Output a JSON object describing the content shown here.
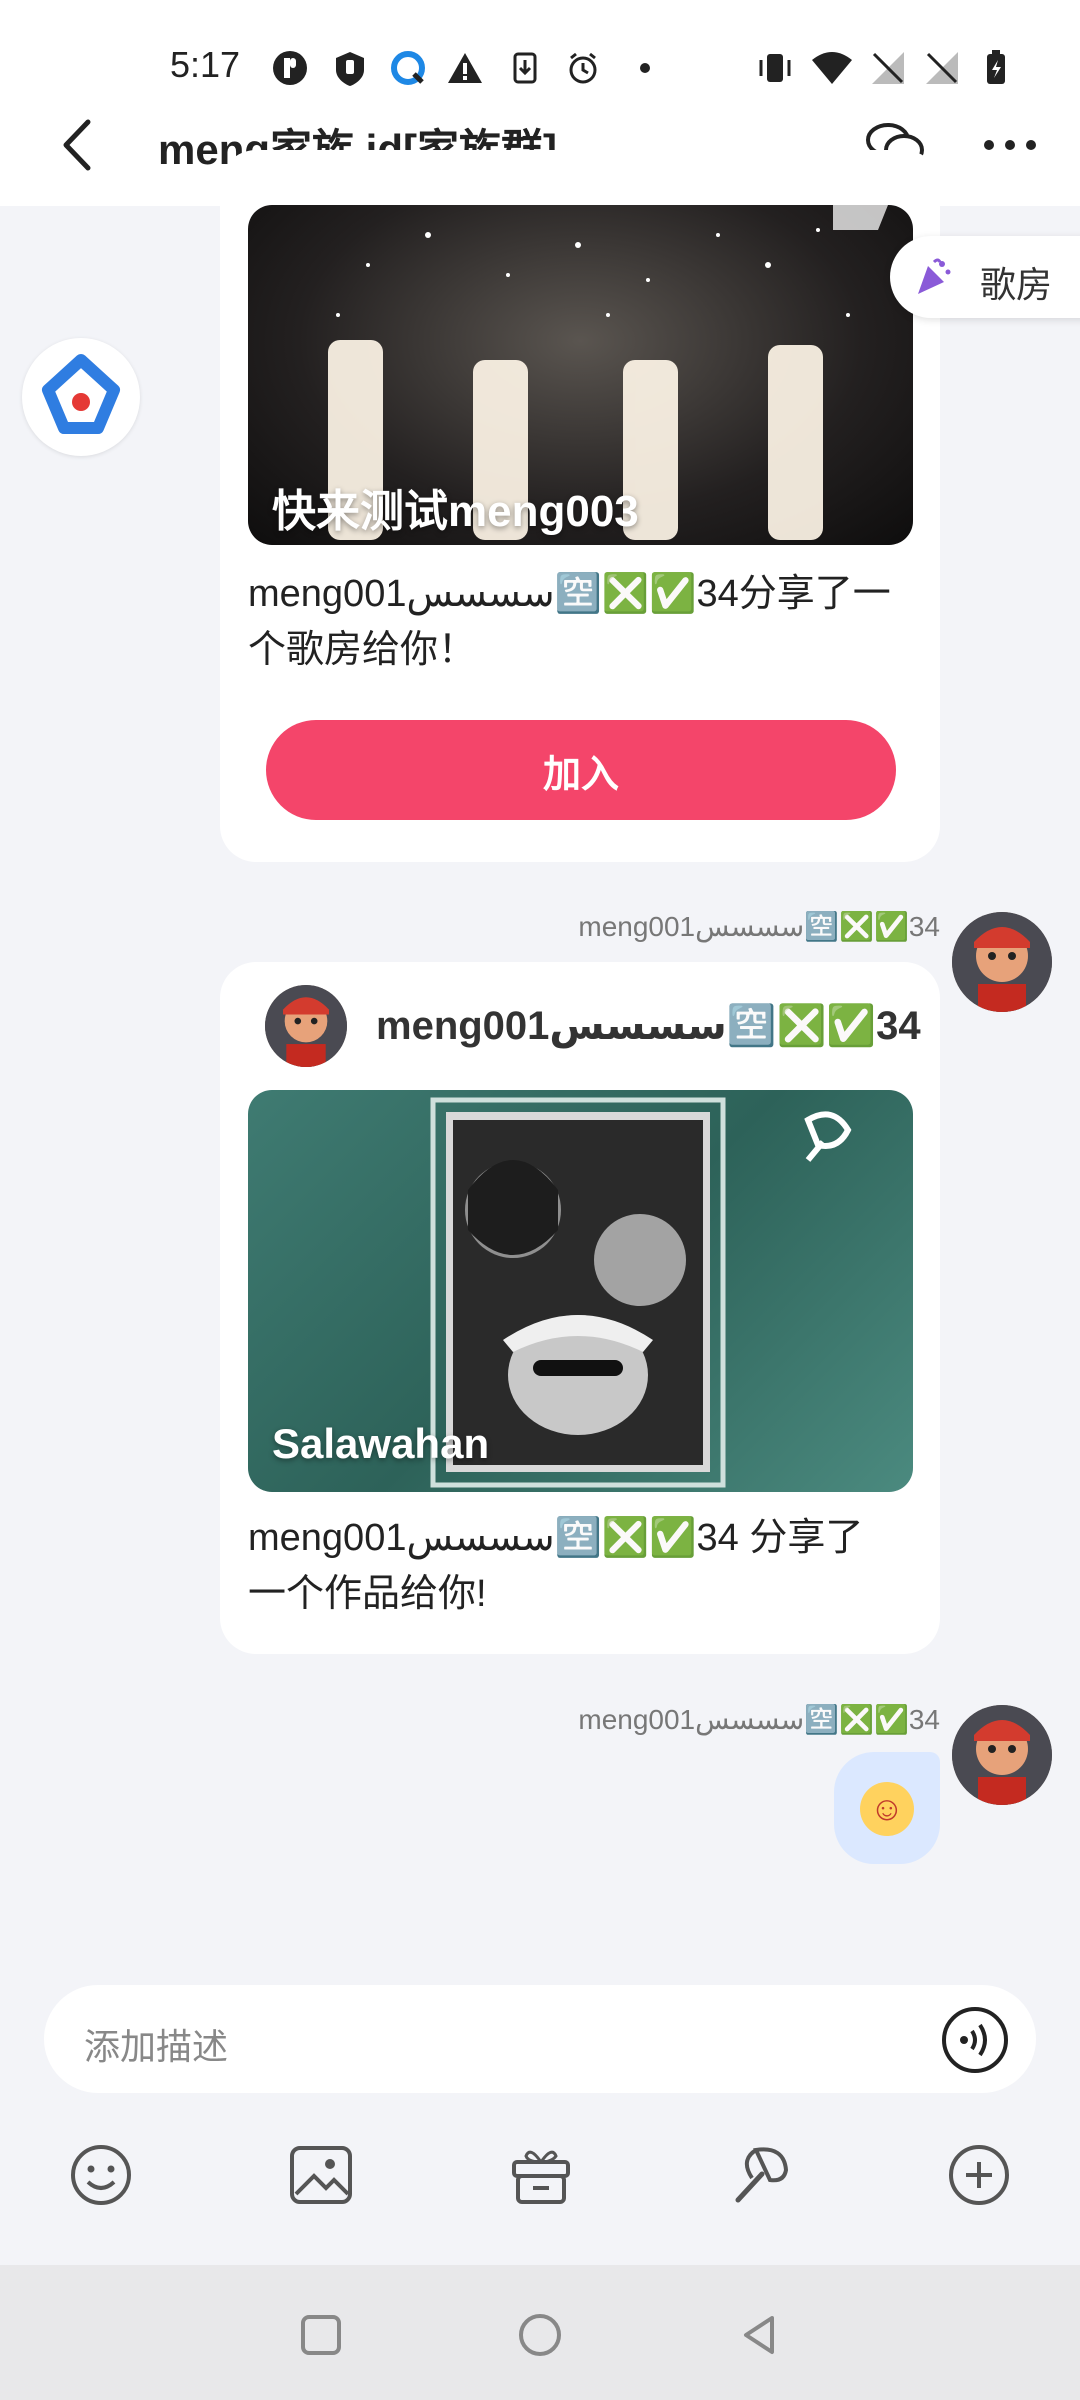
{
  "status_bar": {
    "time": "5:17",
    "left_icons": [
      "p-icon",
      "shield-icon",
      "q-icon",
      "warning-icon",
      "download-icon",
      "alarm-icon",
      "dot-icon"
    ],
    "right_icons": [
      "vibrate-icon",
      "wifi-icon",
      "no-signal-icon",
      "no-signal-icon",
      "battery-icon"
    ]
  },
  "header": {
    "title": "meng家族 id[家族群]",
    "back_icon": "back-chevron-icon",
    "chat_icon": "chat-bubbles-icon",
    "more_icon": "more-dots-icon"
  },
  "floating_chip": {
    "label": "歌房",
    "icon": "party-popper-icon"
  },
  "messages": [
    {
      "type": "room_share",
      "cover_title": "快来测试meng003",
      "text": "meng001سسسس🈳❎✅34分享了一个歌房给你！",
      "button_label": "加入",
      "sender_avatar": "app-logo-avatar"
    },
    {
      "type": "work_share",
      "sender_label": "meng001سسسس🈳❎✅34",
      "card_user": "meng001سسسس🈳❎✅34",
      "cover_title": "Salawahan",
      "text": "meng001سسسس🈳❎✅34 分享了一个作品给你!"
    },
    {
      "type": "emoji",
      "sender_label": "meng001سسسس🈳❎✅34",
      "emoji": "☺"
    }
  ],
  "input": {
    "placeholder": "添加描述",
    "voice_icon": "voice-icon"
  },
  "toolbar": [
    "smiley-icon",
    "image-icon",
    "gift-icon",
    "sing-icon",
    "plus-icon"
  ],
  "nav": [
    "recent-apps-icon",
    "home-icon",
    "back-triangle-icon"
  ]
}
